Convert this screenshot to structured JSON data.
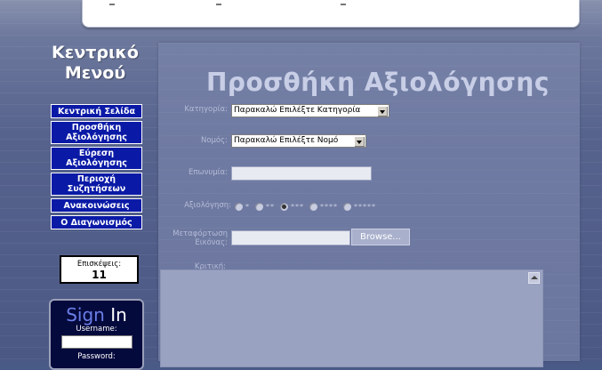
{
  "menu": {
    "title_line1": "Κεντρικό",
    "title_line2": "Μενού",
    "items": [
      {
        "line1": "Κεντρική Σελίδα",
        "line2": ""
      },
      {
        "line1": "Προσθήκη",
        "line2": "Αξιολόγησης"
      },
      {
        "line1": "Εύρεση",
        "line2": "Αξιολόγησης"
      },
      {
        "line1": "Περιοχή",
        "line2": "Συζητήσεων"
      },
      {
        "line1": "Ανακοινώσεις",
        "line2": ""
      },
      {
        "line1": "Ο Διαγωνισμός",
        "line2": ""
      }
    ]
  },
  "visits": {
    "label": "Επισκέψεις:",
    "count": "11"
  },
  "signin": {
    "title_a": "Sign",
    "title_b": "In",
    "username_label": "Username:",
    "password_label": "Password:"
  },
  "form": {
    "title": "Προσθήκη Αξιολόγησης",
    "category_label": "Κατηγορία:",
    "category_value": "Παρακαλώ Επιλέξτε Κατηγορία",
    "prefecture_label": "Νομός:",
    "prefecture_value": "Παρακαλώ Επιλέξτε Νομό",
    "name_label": "Επωνυμία:",
    "rating_label": "Αξιολόγηση:",
    "rating_options": [
      "*",
      "**",
      "***",
      "****",
      "*****"
    ],
    "rating_selected": 2,
    "upload_label_line1": "Μεταφόρτωση",
    "upload_label_line2": "Εικόνας:",
    "browse_label": "Browse...",
    "review_label": "Κριτική:"
  }
}
